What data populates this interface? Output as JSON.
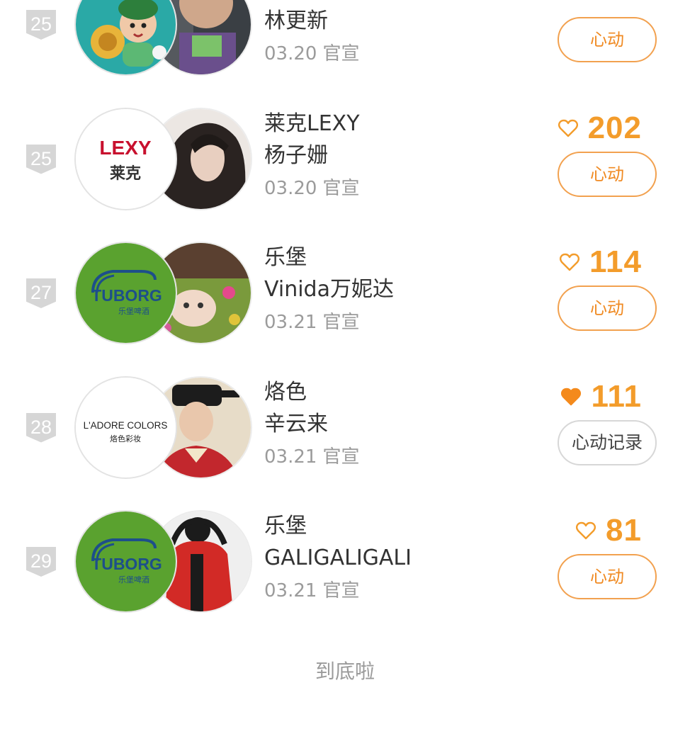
{
  "rows": [
    {
      "rank": "25",
      "brand": "",
      "star": "林更新",
      "date": "03.20",
      "tag": "官宣",
      "likes": "",
      "button_label": "心动",
      "hearted": false,
      "logo": "cartoon-kid",
      "photo": "toy-figure"
    },
    {
      "rank": "25",
      "brand": "莱克LEXY",
      "star": "杨子姗",
      "date": "03.20",
      "tag": "官宣",
      "likes": "202",
      "button_label": "心动",
      "hearted": false,
      "logo": "lexy",
      "photo": "woman-portrait"
    },
    {
      "rank": "27",
      "brand": "乐堡",
      "star": "Vinida万妮达",
      "date": "03.21",
      "tag": "官宣",
      "likes": "114",
      "button_label": "心动",
      "hearted": false,
      "logo": "tuborg",
      "photo": "cat-in-flowers"
    },
    {
      "rank": "28",
      "brand": "烙色",
      "star": "辛云来",
      "date": "03.21",
      "tag": "官宣",
      "likes": "111",
      "button_label": "心动记录",
      "hearted": true,
      "logo": "ladore",
      "photo": "costume-actor"
    },
    {
      "rank": "29",
      "brand": "乐堡",
      "star": "GALIGALIGALI",
      "date": "03.21",
      "tag": "官宣",
      "likes": "81",
      "button_label": "心动",
      "hearted": false,
      "logo": "tuborg",
      "photo": "red-jacket-person"
    }
  ],
  "logo_text": {
    "lexy": "LEXY",
    "lexy_cn": "莱克",
    "tuborg": "TUBORG",
    "tuborg_cn": "乐堡啤酒",
    "ladore": "L'ADORE COLORS",
    "ladore_cn": "烙色彩妆"
  },
  "footer": "到底啦",
  "colors": {
    "accent": "#f39c2b",
    "button_border": "#f2a14f",
    "rank_badge": "#d6d6d6",
    "tuborg_green": "#5aa22f",
    "lexy_red": "#c8102e"
  }
}
